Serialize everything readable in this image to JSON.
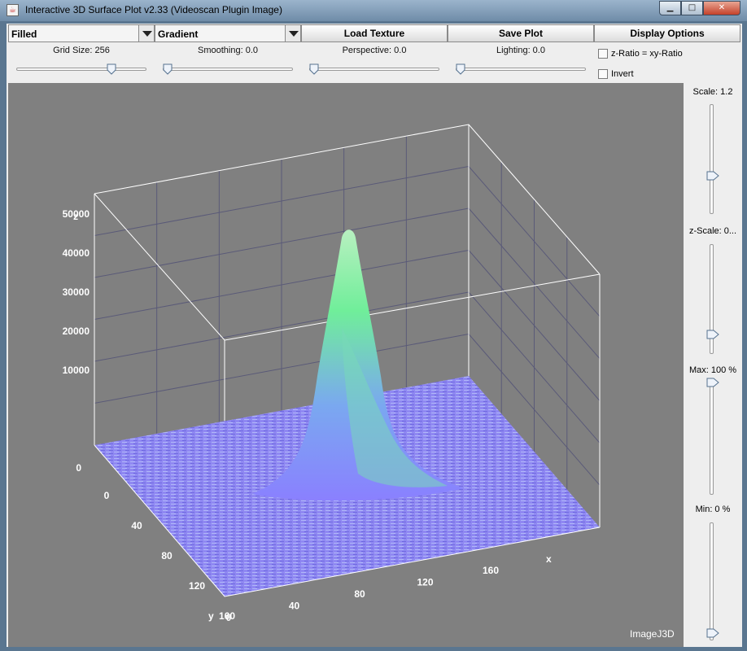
{
  "window": {
    "title": "Interactive 3D Surface Plot v2.33  (Videoscan Plugin Image)"
  },
  "toolbar": {
    "render_mode": "Filled",
    "color_mode": "Gradient",
    "load_texture": "Load Texture",
    "save_plot": "Save Plot",
    "display_options": "Display Options"
  },
  "controls": {
    "grid_size": {
      "label": "Grid Size: 256",
      "fraction": 0.75
    },
    "smoothing": {
      "label": "Smoothing: 0.0",
      "fraction": 0.0
    },
    "perspective": {
      "label": "Perspective: 0.0",
      "fraction": 0.0
    },
    "lighting": {
      "label": "Lighting: 0.0",
      "fraction": 0.0
    },
    "z_ratio": {
      "label": "z-Ratio = xy-Ratio",
      "checked": false
    },
    "invert": {
      "label": "Invert",
      "checked": false
    }
  },
  "side": {
    "scale": {
      "label": "Scale: 1.2"
    },
    "z_scale": {
      "label": "z-Scale: 0..."
    },
    "max": {
      "label": "Max: 100 %"
    },
    "min": {
      "label": "Min: 0 %"
    }
  },
  "plot": {
    "z_axis": {
      "label": "z",
      "ticks": [
        "0",
        "10000",
        "20000",
        "30000",
        "40000",
        "50000"
      ]
    },
    "x_axis": {
      "label": "x",
      "ticks": [
        "0",
        "40",
        "80",
        "120",
        "160"
      ]
    },
    "y_axis": {
      "label": "y",
      "ticks": [
        "0",
        "40",
        "80",
        "120",
        "160"
      ]
    },
    "watermark": "ImageJ3D",
    "colors": {
      "background": "#808080",
      "box": "#ffffff",
      "grid": "#5a5a78",
      "surface_low": "#8a80ff",
      "surface_high": "#80ff80"
    }
  }
}
